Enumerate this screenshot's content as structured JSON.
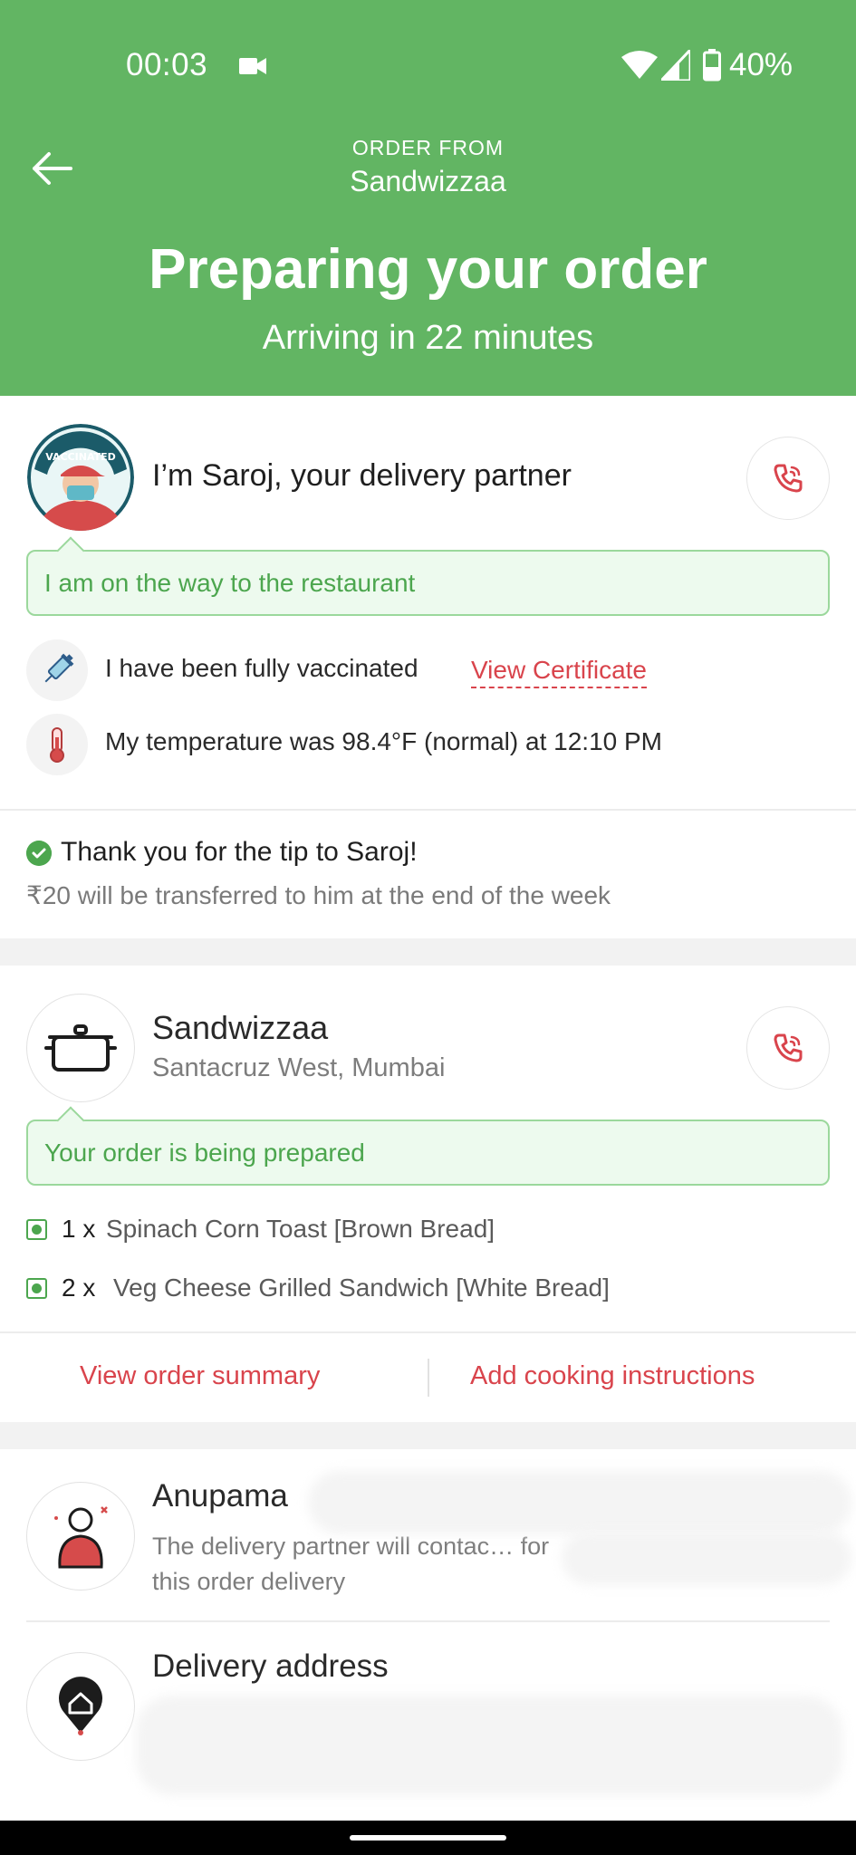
{
  "status_bar": {
    "time": "00:03",
    "battery": "40%"
  },
  "header": {
    "order_from_label": "ORDER FROM",
    "restaurant": "Sandwizzaa",
    "status_title": "Preparing your order",
    "status_sub": "Arriving in 22 minutes",
    "color": "#62b563"
  },
  "partner": {
    "avatar_badge": "VACCINATED",
    "title": "I’m Saroj, your delivery partner",
    "status_msg": "I am on the way to the restaurant",
    "vaccinated_text": "I have been fully vaccinated",
    "view_certificate": "View Certificate",
    "temperature_text": "My temperature was 98.4°F (normal) at 12:10 PM"
  },
  "tip": {
    "title": "Thank you for the tip to Saroj!",
    "sub": "₹20 will be transferred to him at the end of the week"
  },
  "restaurant": {
    "name": "Sandwizzaa",
    "location": "Santacruz West, Mumbai",
    "status_msg": "Your order is being prepared",
    "items": [
      {
        "qty": "1 x",
        "name": "Spinach Corn Toast [Brown Bread]"
      },
      {
        "qty": "2 x",
        "name": "Veg Cheese Grilled Sandwich [White Bread]"
      }
    ]
  },
  "actions": {
    "view_summary": "View order summary",
    "add_instructions": "Add cooking instructions"
  },
  "contact": {
    "name": "Anupama",
    "note": "The delivery partner will contac… for this order delivery"
  },
  "address": {
    "title": "Delivery address"
  },
  "accent_red": "#d9444c",
  "accent_green": "#4ca64e"
}
